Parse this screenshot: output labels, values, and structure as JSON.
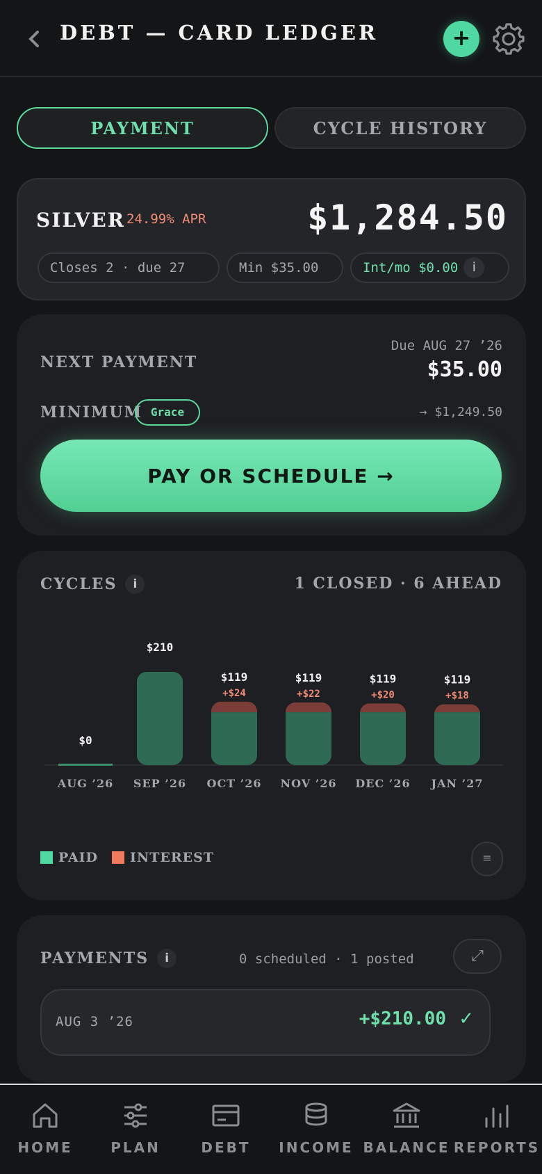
{
  "header": {
    "back_icon": "chevron-left-icon",
    "title": "DEBT — CARD LEDGER",
    "add_label": "+",
    "settings_icon": "gear-icon"
  },
  "tabs": [
    {
      "label": "PAYMENT",
      "active": true
    },
    {
      "label": "CYCLE HISTORY",
      "active": false
    }
  ],
  "account": {
    "name": "SILVER",
    "apr": "24.99% APR",
    "balance": "$1,284.50",
    "chips": {
      "closes": "Closes 2 · due 27",
      "min": "Min $35.00",
      "interest": "Int/mo $0.00",
      "info": "i"
    }
  },
  "next_payment": {
    "label": "NEXT PAYMENT",
    "due": "Due AUG 27 ’26",
    "amount": "$35.00",
    "minimum_label": "MINIMUM",
    "badge": "Grace",
    "after": "→ $1,249.50",
    "cta": "PAY OR SCHEDULE →"
  },
  "cycles": {
    "label": "CYCLES",
    "info": "i",
    "summary": "1 CLOSED · 6 AHEAD",
    "legend": [
      {
        "label": "PAID",
        "color": "#4fd8a0"
      },
      {
        "label": "INTEREST",
        "color": "#f07a5a"
      }
    ],
    "list_icon": "≡"
  },
  "chart_data": {
    "type": "bar",
    "stacked": true,
    "categories": [
      "AUG ’26",
      "SEP ’26",
      "OCT ’26",
      "NOV ’26",
      "DEC ’26",
      "JAN ’27"
    ],
    "series": [
      {
        "name": "PAID",
        "values": [
          0,
          210,
          119,
          119,
          119,
          119
        ],
        "color": "#2f6a55"
      },
      {
        "name": "INTEREST",
        "values": [
          0,
          0,
          24,
          22,
          20,
          18
        ],
        "color": "#7a3d38"
      }
    ],
    "value_labels": [
      "$0",
      "$210",
      "$119",
      "$119",
      "$119",
      "$119"
    ],
    "interest_labels": [
      "",
      "",
      "+$24",
      "+$22",
      "+$20",
      "+$18"
    ],
    "ylim": [
      0,
      210
    ],
    "grid": false,
    "legend": "bottom-left"
  },
  "payments": {
    "label": "PAYMENTS",
    "info": "i",
    "summary": "0 scheduled · 1 posted",
    "expand_icon": "⤢",
    "rows": [
      {
        "date": "AUG 3 ’26",
        "amount": "+$210.00",
        "status_icon": "✓"
      }
    ]
  },
  "nav": [
    {
      "label": "HOME",
      "icon": "home-icon"
    },
    {
      "label": "PLAN",
      "icon": "sliders-icon"
    },
    {
      "label": "DEBT",
      "icon": "card-icon"
    },
    {
      "label": "INCOME",
      "icon": "coins-icon"
    },
    {
      "label": "BALANCE",
      "icon": "bank-icon"
    },
    {
      "label": "REPORTS",
      "icon": "bar-chart-icon"
    }
  ]
}
